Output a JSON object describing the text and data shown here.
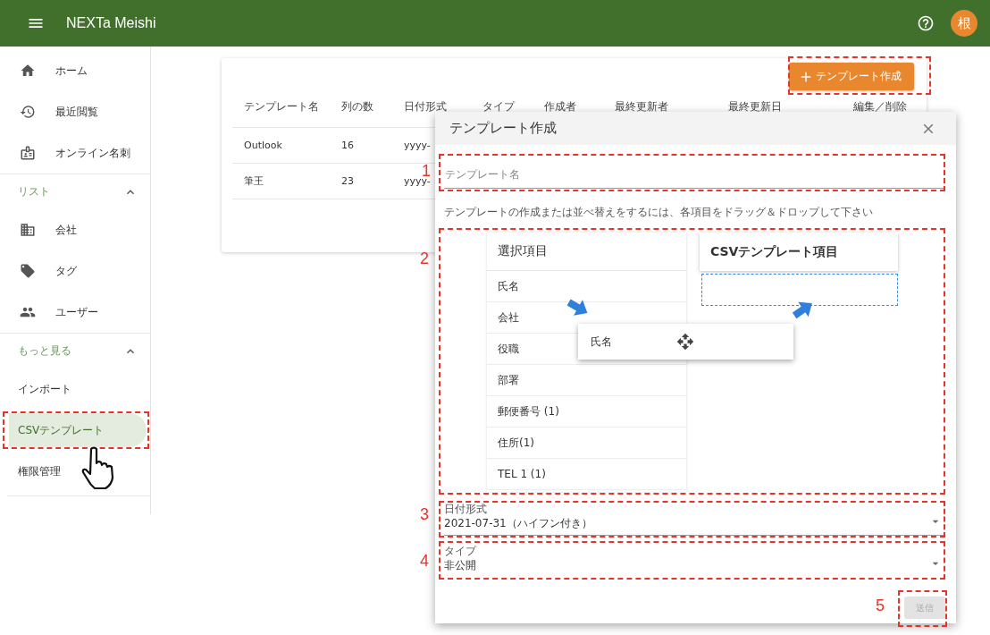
{
  "app_bar": {
    "title": "NEXTa Meishi",
    "avatar": "根"
  },
  "sidebar": {
    "items": [
      {
        "label": "ホーム",
        "selected": false
      },
      {
        "label": "最近閲覧",
        "selected": false
      },
      {
        "label": "オンライン名刺",
        "selected": false
      }
    ],
    "sections": [
      {
        "title": "リスト",
        "expanded": true,
        "items": [
          {
            "label": "会社",
            "selected": false
          },
          {
            "label": "タグ",
            "selected": false
          },
          {
            "label": "ユーザー",
            "selected": false
          }
        ]
      },
      {
        "title": "もっと見る",
        "expanded": true,
        "items": [
          {
            "label": "インポート",
            "selected": false
          },
          {
            "label": "CSVテンプレート",
            "selected": true
          },
          {
            "label": "権限管理",
            "selected": false
          }
        ]
      }
    ]
  },
  "create_button": "テンプレート作成",
  "table": {
    "columns": [
      "テンプレート名",
      "列の数",
      "日付形式",
      "タイプ",
      "作成者",
      "最終更新者",
      "最終更新日",
      "編集／削除"
    ],
    "rows": [
      [
        "Outlook",
        "16",
        "yyyy-"
      ],
      [
        "筆王",
        "23",
        "yyyy-"
      ]
    ]
  },
  "dialog": {
    "title": "テンプレート作成",
    "name_field": {
      "placeholder": "テンプレート名"
    },
    "hint": "テンプレートの作成または並べ替えをするには、各項目をドラッグ＆ドロップして下さい",
    "source_list": {
      "title": "選択項目",
      "items": [
        "氏名",
        "会社",
        "役職",
        "部署",
        "郵便番号 (1)",
        "住所(1)",
        "TEL 1 (1)"
      ]
    },
    "target_list": {
      "title": "CSVテンプレート項目"
    },
    "dragged_item": "氏名",
    "date_format": {
      "label": "日付形式",
      "value": "2021-07-31（ハイフン付き）"
    },
    "type": {
      "label": "タイプ",
      "value": "非公開"
    },
    "submit": {
      "label": "送信",
      "disabled": true
    }
  },
  "annotations": [
    {
      "number": "1"
    },
    {
      "number": "2"
    },
    {
      "number": "3"
    },
    {
      "number": "4"
    },
    {
      "number": "5"
    }
  ]
}
